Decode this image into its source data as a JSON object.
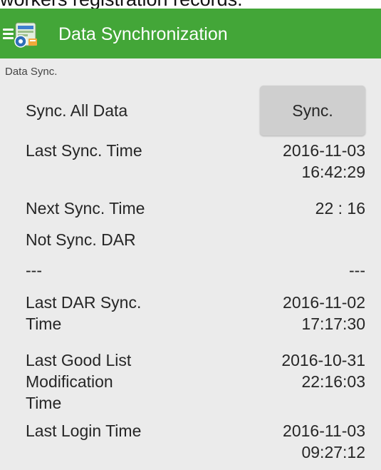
{
  "caption": "workers registration records.",
  "appbar": {
    "title": "Data Synchronization",
    "menu_icon": "menu-icon",
    "app_icon": "data-sync-app-icon"
  },
  "section_label": "Data Sync.",
  "rows": [
    {
      "label": "Sync. All Data",
      "button": "Sync."
    },
    {
      "label": "Last Sync. Time",
      "value": "2016-11-03\n16:42:29"
    },
    {
      "label": "Next Sync. Time",
      "value": "22 : 16"
    },
    {
      "label": "Not Sync. DAR",
      "value": ""
    },
    {
      "label": "---",
      "value": "---"
    },
    {
      "label": "Last DAR Sync.\nTime",
      "value": "2016-11-02\n17:17:30"
    },
    {
      "label": "Last Good List\nModification\nTime",
      "value": "2016-10-31\n22:16:03"
    },
    {
      "label": "Last Login Time",
      "value": "2016-11-03\n09:27:12"
    }
  ],
  "colors": {
    "appbar": "#43a638",
    "background": "#ebebeb",
    "button": "#cfcfcf"
  }
}
